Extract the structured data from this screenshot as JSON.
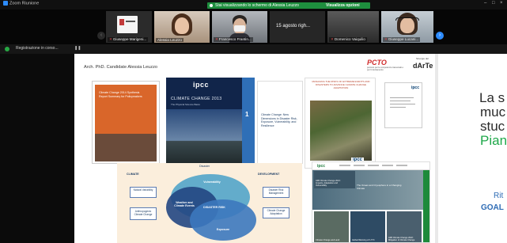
{
  "app": {
    "title": "Zoom Riunione"
  },
  "share_banner": {
    "text": "Stai visualizzando lo schermo di Alessia Leuzzo",
    "options": "Visualizza opzioni"
  },
  "participants": [
    {
      "name": "Giuseppe Marigeni..."
    },
    {
      "name": "Alessia Leuzzo"
    },
    {
      "name": "Francesco Frantin..."
    },
    {
      "name": "15 agosto righ..."
    },
    {
      "name": "Domenico Vaiquilio"
    },
    {
      "name": "Giuseppe Lucani..."
    }
  ],
  "recording": {
    "status": "Registrazione in corso..."
  },
  "slide": {
    "author": "Arch. PhD. Candidate Alessia Leuzzo",
    "pcto": "PCTO",
    "pcto_sub": "percorsi per le competenze trasversali e per l'orientamento",
    "darte_label": "Sinergie del",
    "darte": "dArTe",
    "cover_orange": "Climate Change 2014 Synthesis Report Summary for Policymakers",
    "cover_ipcc_logo": "ipcc",
    "cover_ipcc_title": "CLIMATE CHANGE 2013",
    "cover_ipcc_sub": "The Physical Science Basis",
    "cover_blue_number": "1",
    "cover_white": "Climate Change: New Dimensions in Disaster Risk, Exposure, Vulnerability, and Resilience",
    "cover_srex": "MANAGING THE RISKS OF EXTREME EVENTS AND DISASTERS TO ADVANCE CLIMATE CHANGE ADAPTATION",
    "cover_srex_logo": "ipcc",
    "cover_page_logo": "ipcc",
    "diagram": {
      "climate": "CLIMATE",
      "development": "DEVELOPMENT",
      "disaster": "Disaster",
      "vulnerability": "Vulnerability",
      "weather": "Weather and Climate Events",
      "risk": "DISASTER RISK",
      "exposure": "Exposure",
      "natural": "Natural Variability",
      "anthropogenic": "Anthropogenic Climate Change",
      "drm": "Disaster Risk Management",
      "cca": "Climate Change Adaptation"
    },
    "web": {
      "logo": "ipcc",
      "hero": "The Ocean and Cryosphere in a Changing Climate",
      "tile1": "AR6 Climate Change 2021: Impacts, Adaptation and Vulnerability",
      "tile2": "Global Warming of 1.5°C",
      "tile3": "Climate Change and Land",
      "tile4": "AR6 Climate Change 2022: Mitigation of Climate Change"
    }
  },
  "right_panel": {
    "line1": "La s",
    "line2": "muc",
    "line3": "stuc",
    "line4": "Pian",
    "footer1": "Rit",
    "footer2": "GOAL"
  },
  "colors": {
    "zoom_blue": "#2d8cff",
    "share_green": "#1e8e3e",
    "accent_green": "#1fa84a",
    "link_blue": "#2e6cb5",
    "ipcc_navy": "#11254a"
  }
}
